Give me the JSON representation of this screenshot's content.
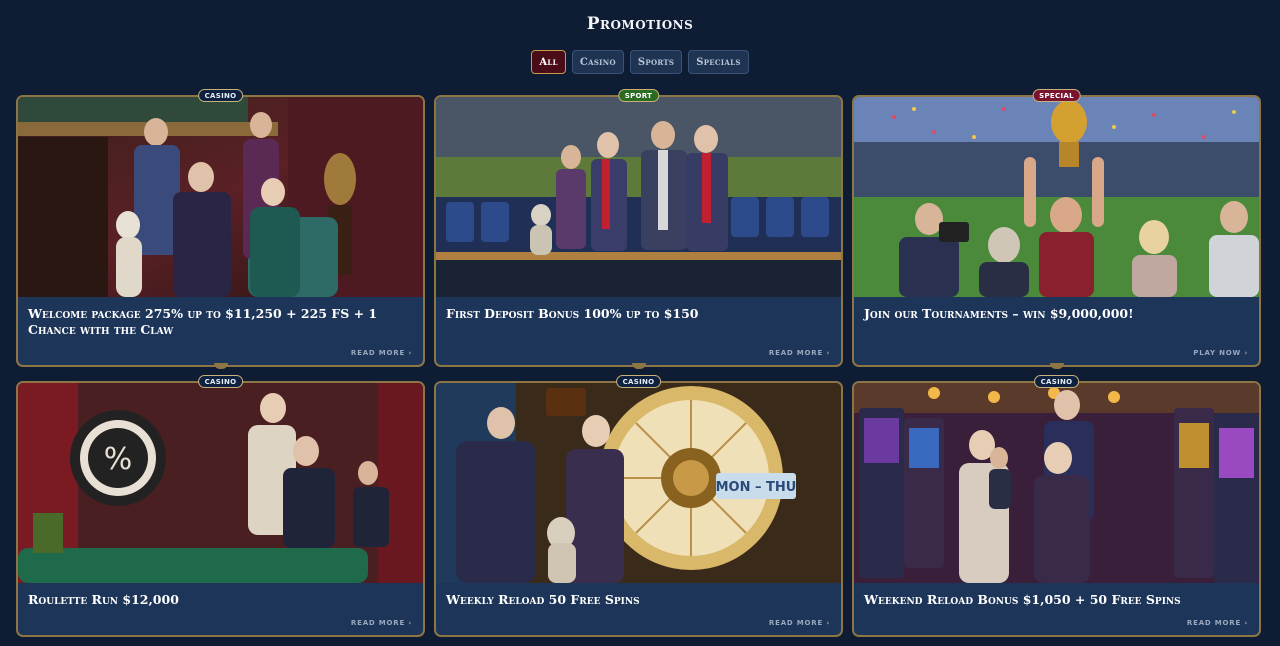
{
  "page": {
    "title": "Promotions"
  },
  "filters": [
    {
      "label": "All",
      "active": true
    },
    {
      "label": "Casino",
      "active": false
    },
    {
      "label": "Sports",
      "active": false
    },
    {
      "label": "Specials",
      "active": false
    }
  ],
  "colors": {
    "background": "#0e1d33",
    "card": "#1d3558",
    "card_border": "#8d7545",
    "active_filter": "#4a0d18"
  },
  "promotions": [
    {
      "badge": "Casino",
      "title": "Welcome package 275% up to $11,250 + 225 FS + 1 Chance with the Claw",
      "cta": "Read more",
      "image": "casino-lounge-group-with-dog"
    },
    {
      "badge": "Sport",
      "title": "First Deposit Bonus 100% up to $150",
      "cta": "Read more",
      "image": "stadium-fans-with-scarves"
    },
    {
      "badge": "Special",
      "title": "Join our Tournaments – win $9,000,000!",
      "cta": "Play now",
      "image": "trophy-celebration-stadium"
    },
    {
      "badge": "Casino",
      "title": "Roulette Run $12,000",
      "cta": "Read more",
      "image": "roulette-table-percent-chip"
    },
    {
      "badge": "Casino",
      "title": "Weekly Reload 50 Free Spins",
      "cta": "Read more",
      "image": "wheel-of-fortune-mon-thu"
    },
    {
      "badge": "Casino",
      "title": "Weekend Reload Bonus $1,050 + 50 Free Spins",
      "cta": "Read more",
      "image": "slot-machines-hall"
    }
  ],
  "image_text": {
    "wheel_sign": "MON – THU",
    "chip_symbol": "%"
  }
}
